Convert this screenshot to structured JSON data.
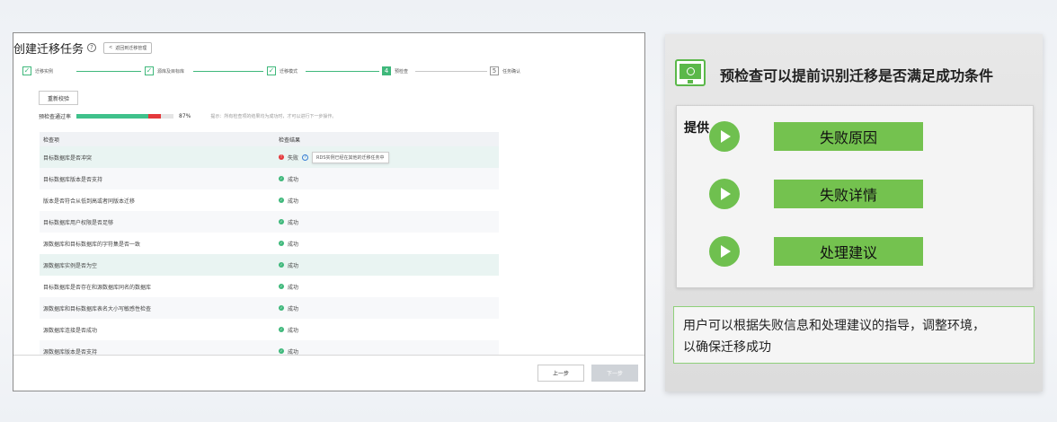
{
  "screenshot": {
    "title": "创建迁移任务",
    "back_button": "返回到迁移管理",
    "steps": [
      {
        "index": "✓",
        "label": "迁移实例",
        "state": "done"
      },
      {
        "index": "✓",
        "label": "源库及目标库",
        "state": "done"
      },
      {
        "index": "✓",
        "label": "迁移模式",
        "state": "done"
      },
      {
        "index": "4",
        "label": "预检查",
        "state": "active"
      },
      {
        "index": "5",
        "label": "任务确认",
        "state": "todo"
      }
    ],
    "recheck_button": "重新校验",
    "progress": {
      "label": "预检查通过率",
      "percent_text": "87%",
      "pass_fraction": 0.87,
      "tip": "提示：所有检查项的结果均为成功时，才可以进行下一步操作。"
    },
    "table": {
      "headers": [
        "检查项",
        "检查结果"
      ],
      "rows": [
        {
          "item": "目标数据库是否冲突",
          "status": "fail",
          "result": "失败",
          "tooltip": "RDS实例已经在其他的迁移任务中"
        },
        {
          "item": "目标数据库版本是否支持",
          "status": "ok",
          "result": "成功"
        },
        {
          "item": "版本是否符合从低到高或者同版本迁移",
          "status": "ok",
          "result": "成功"
        },
        {
          "item": "目标数据库用户权限是否足够",
          "status": "ok",
          "result": "成功"
        },
        {
          "item": "源数据库和目标数据库的字符集是否一致",
          "status": "ok",
          "result": "成功"
        },
        {
          "item": "源数据库实例是否为空",
          "status": "ok",
          "result": "成功"
        },
        {
          "item": "目标数据库是否存在和源数据库同名的数据库",
          "status": "ok",
          "result": "成功"
        },
        {
          "item": "源数据库和目标数据库表名大小写敏感性检查",
          "status": "ok",
          "result": "成功"
        },
        {
          "item": "源数据库连接是否成功",
          "status": "ok",
          "result": "成功"
        },
        {
          "item": "源数据库版本是否支持",
          "status": "ok",
          "result": "成功"
        }
      ]
    },
    "footer": {
      "prev": "上一步",
      "next": "下一步"
    }
  },
  "panel": {
    "heading": "预检查可以提前识别迁移是否满足成功条件",
    "provide_label": "提供",
    "features": [
      "失败原因",
      "失败详情",
      "处理建议"
    ],
    "note_line1": "用户可以根据失败信息和处理建议的指导，调整环境，",
    "note_line2": "以确保迁移成功",
    "accent_color": "#74c24f"
  }
}
